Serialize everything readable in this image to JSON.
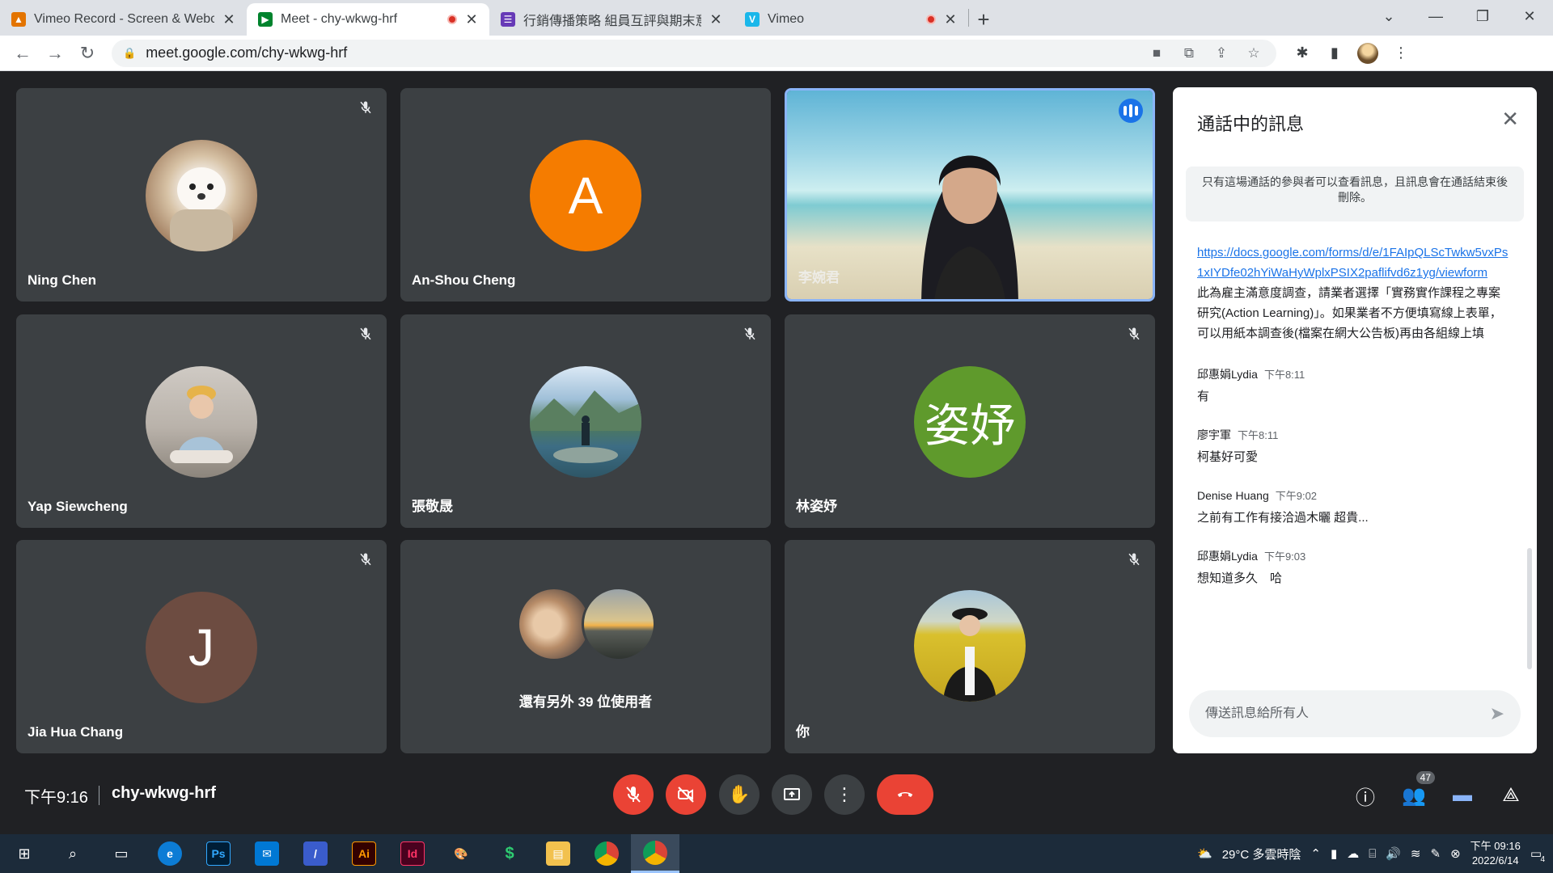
{
  "browser": {
    "tabs": [
      {
        "title": "Vimeo Record - Screen & Webc",
        "color": "#e37400",
        "icon": "vimeo-record-favicon",
        "recording": false
      },
      {
        "title": "Meet - chy-wkwg-hrf",
        "color": "#00832d",
        "icon": "meet-favicon",
        "recording": true
      },
      {
        "title": "行銷傳播策略 組員互評與期末意",
        "color": "#673ab7",
        "icon": "forms-favicon",
        "recording": false
      },
      {
        "title": "Vimeo",
        "color": "#1ab7ea",
        "icon": "vimeo-favicon",
        "recording": true
      }
    ],
    "url": "meet.google.com/chy-wkwg-hrf"
  },
  "tiles": [
    {
      "name": "Ning Chen",
      "avatar_type": "photo",
      "avatar_color": "#c9a47a",
      "muted": true
    },
    {
      "name": "An-Shou Cheng",
      "avatar_type": "letter",
      "letter": "A",
      "avatar_color": "#f57c00",
      "muted": false
    },
    {
      "name": "李婉君",
      "avatar_type": "video",
      "muted": false,
      "speaking": true
    },
    {
      "name": "Yap Siewcheng",
      "avatar_type": "photo",
      "avatar_color": "#d7cbbd",
      "muted": true
    },
    {
      "name": "張敬晟",
      "avatar_type": "photo",
      "avatar_color": "#4f7a8a",
      "muted": true
    },
    {
      "name": "林姿妤",
      "avatar_type": "letter",
      "letter": "姿妤",
      "avatar_color": "#5f9a2c",
      "muted": true
    },
    {
      "name": "Jia Hua Chang",
      "avatar_type": "letter",
      "letter": "J",
      "avatar_color": "#6d4c41",
      "muted": true
    },
    {
      "name": "還有另外 39 位使用者",
      "avatar_type": "group",
      "muted": false
    },
    {
      "name": "你",
      "avatar_type": "photo",
      "avatar_color": "#c8b12a",
      "muted": true
    }
  ],
  "chat": {
    "title": "通話中的訊息",
    "notice": "只有這場通話的參與者可以查看訊息，且訊息會在通話結束後刪除。",
    "link": "https://docs.google.com/forms/d/e/1FAIpQLScTwkw5vxPs1xIYDfe02hYiWaHyWplxPSIX2paflifvd6z1yg/viewform",
    "link_desc": "此為雇主滿意度調查，請業者選擇「實務實作課程之專案研究(Action Learning)」。如果業者不方便填寫線上表單，可以用紙本調查後(檔案在網大公告板)再由各組線上填",
    "messages": [
      {
        "sender": "邱惠娟Lydia",
        "time": "下午8:11",
        "text": "有"
      },
      {
        "sender": "廖宇軍",
        "time": "下午8:11",
        "text": "柯基好可愛"
      },
      {
        "sender": "Denise Huang",
        "time": "下午9:02",
        "text": "之前有工作有接洽過木曬 超貴..."
      },
      {
        "sender": "邱惠娟Lydia",
        "time": "下午9:03",
        "text": "想知道多久　哈"
      }
    ],
    "input_placeholder": "傳送訊息給所有人"
  },
  "controls": {
    "time": "下午9:16",
    "meeting_code": "chy-wkwg-hrf",
    "participant_count": "47"
  },
  "taskbar": {
    "weather": "29°C 多雲時陰",
    "clock_time": "下午 09:16",
    "clock_date": "2022/6/14",
    "notification_count": "4"
  }
}
